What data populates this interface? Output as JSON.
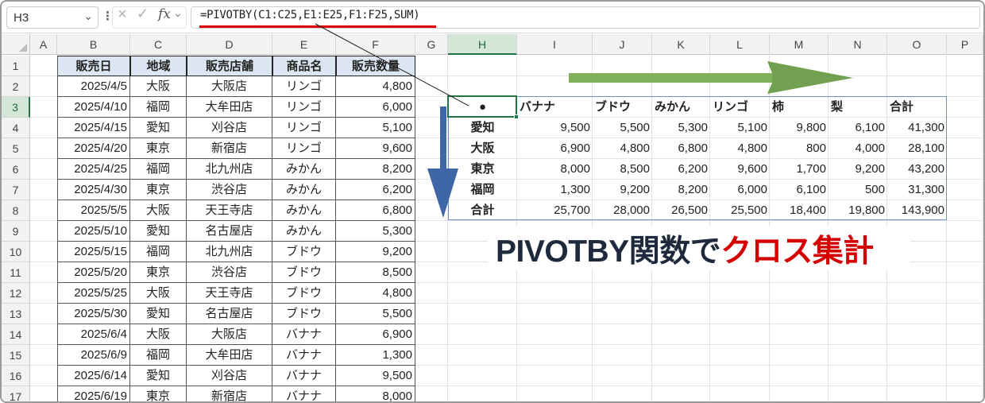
{
  "formula_bar": {
    "name_box": "H3",
    "formula": "=PIVOTBY(C1:C25,E1:E25,F1:F25,SUM)",
    "fx_label": "fx"
  },
  "columns": [
    "A",
    "B",
    "C",
    "D",
    "E",
    "F",
    "G",
    "H",
    "I",
    "J",
    "K",
    "L",
    "M",
    "N",
    "O",
    "P"
  ],
  "active_column": "H",
  "rows": [
    "1",
    "2",
    "3",
    "4",
    "5",
    "6",
    "7",
    "8",
    "9",
    "10",
    "11",
    "12",
    "13",
    "14",
    "15",
    "16",
    "17"
  ],
  "active_row": "3",
  "source_table": {
    "headers": [
      "販売日",
      "地域",
      "販売店舗",
      "商品名",
      "販売数量"
    ],
    "rows": [
      [
        "2025/4/5",
        "大阪",
        "大阪店",
        "リンゴ",
        "4,800"
      ],
      [
        "2025/4/10",
        "福岡",
        "大牟田店",
        "リンゴ",
        "6,000"
      ],
      [
        "2025/4/15",
        "愛知",
        "刈谷店",
        "リンゴ",
        "5,100"
      ],
      [
        "2025/4/20",
        "東京",
        "新宿店",
        "リンゴ",
        "9,600"
      ],
      [
        "2025/4/25",
        "福岡",
        "北九州店",
        "みかん",
        "8,200"
      ],
      [
        "2025/4/30",
        "東京",
        "渋谷店",
        "みかん",
        "6,200"
      ],
      [
        "2025/5/5",
        "大阪",
        "天王寺店",
        "みかん",
        "6,800"
      ],
      [
        "2025/5/10",
        "愛知",
        "名古屋店",
        "みかん",
        "5,300"
      ],
      [
        "2025/5/15",
        "福岡",
        "北九州店",
        "ブドウ",
        "9,200"
      ],
      [
        "2025/5/20",
        "東京",
        "渋谷店",
        "ブドウ",
        "8,500"
      ],
      [
        "2025/5/25",
        "大阪",
        "天王寺店",
        "ブドウ",
        "4,800"
      ],
      [
        "2025/5/30",
        "愛知",
        "名古屋店",
        "ブドウ",
        "5,500"
      ],
      [
        "2025/6/4",
        "大阪",
        "大阪店",
        "バナナ",
        "6,900"
      ],
      [
        "2025/6/9",
        "福岡",
        "大牟田店",
        "バナナ",
        "1,300"
      ],
      [
        "2025/6/14",
        "愛知",
        "刈谷店",
        "バナナ",
        "9,500"
      ],
      [
        "2025/6/19",
        "東京",
        "新宿店",
        "バナナ",
        "8,000"
      ]
    ]
  },
  "pivot_table": {
    "corner": "●",
    "col_headers": [
      "バナナ",
      "ブドウ",
      "みかん",
      "リンゴ",
      "柿",
      "梨",
      "合計"
    ],
    "rows": [
      {
        "label": "愛知",
        "values": [
          "9,500",
          "5,500",
          "5,300",
          "5,100",
          "9,800",
          "6,100",
          "41,300"
        ]
      },
      {
        "label": "大阪",
        "values": [
          "6,900",
          "4,800",
          "6,800",
          "4,800",
          "800",
          "4,000",
          "28,100"
        ]
      },
      {
        "label": "東京",
        "values": [
          "8,000",
          "8,500",
          "6,200",
          "9,600",
          "1,700",
          "9,200",
          "43,200"
        ]
      },
      {
        "label": "福岡",
        "values": [
          "1,300",
          "9,200",
          "8,200",
          "6,000",
          "6,100",
          "500",
          "31,300"
        ]
      },
      {
        "label": "合計",
        "values": [
          "25,700",
          "28,000",
          "26,500",
          "25,500",
          "18,400",
          "19,800",
          "143,900"
        ]
      }
    ]
  },
  "caption": {
    "main": "PIVOTBY関数で",
    "accent": "クロス集計"
  },
  "colors": {
    "arrow_green": "#6a9b48",
    "arrow_blue": "#3f67a8",
    "header_fill": "#dce6f3",
    "selection": "#217346",
    "accent_red": "#d40000"
  }
}
